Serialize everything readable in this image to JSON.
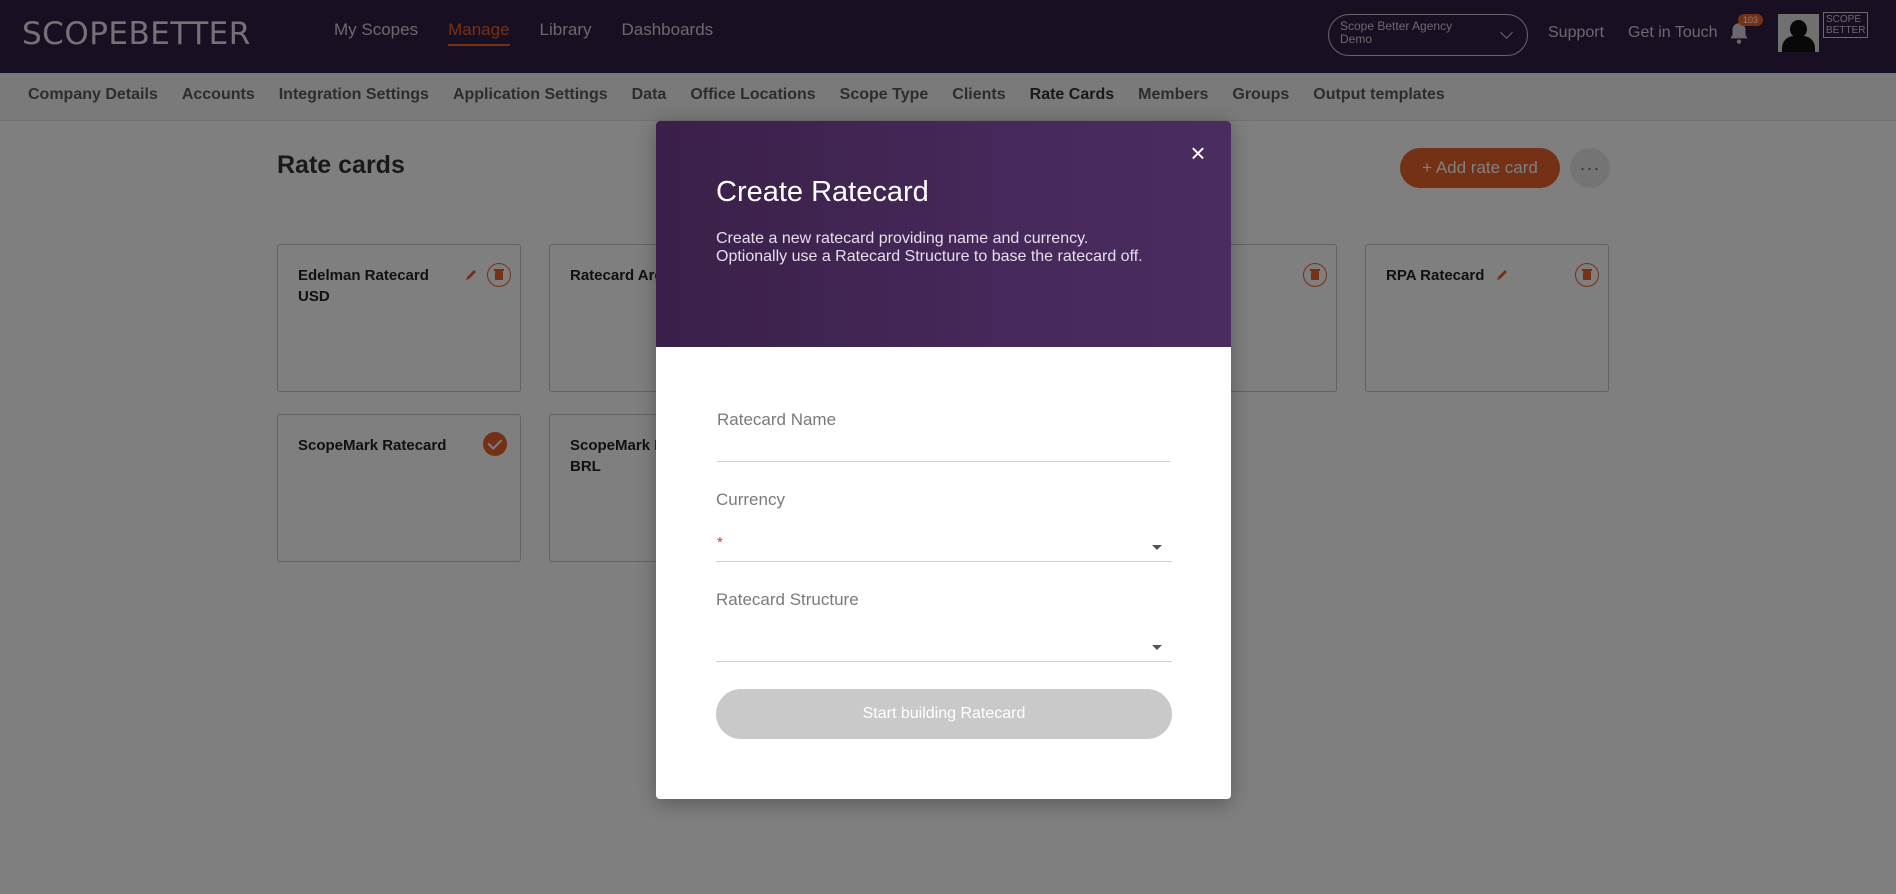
{
  "brand": {
    "logo_text": "SCOPEBETTER",
    "accent": "#e8622a",
    "header_bg": "#321f44"
  },
  "main_nav": [
    {
      "label": "My Scopes"
    },
    {
      "label": "Manage",
      "active": true
    },
    {
      "label": "Library"
    },
    {
      "label": "Dashboards"
    }
  ],
  "agency_select": {
    "line1": "Scope Better Agency",
    "line2": "Demo"
  },
  "top_links": {
    "support": "Support",
    "contact": "Get in Touch"
  },
  "notifications": {
    "count": "103"
  },
  "minilogo": {
    "line1": "SCOPE",
    "line2": "BETTER"
  },
  "sub_nav": [
    {
      "label": "Company Details"
    },
    {
      "label": "Accounts"
    },
    {
      "label": "Integration Settings"
    },
    {
      "label": "Application Settings"
    },
    {
      "label": "Data"
    },
    {
      "label": "Office Locations"
    },
    {
      "label": "Scope Type"
    },
    {
      "label": "Clients"
    },
    {
      "label": "Rate Cards",
      "active": true
    },
    {
      "label": "Members"
    },
    {
      "label": "Groups"
    },
    {
      "label": "Output templates"
    }
  ],
  "page": {
    "title": "Rate cards",
    "add_button": "+ Add rate card",
    "more_button": "···"
  },
  "cards": [
    {
      "name": "Edelman Ratecard USD"
    },
    {
      "name": "Ratecard Argentina"
    },
    {
      "name": "RPA Ratecard"
    },
    {
      "name": "ScopeMark Ratecard",
      "default": true
    },
    {
      "name": "ScopeMark Ratecard BRL"
    }
  ],
  "modal": {
    "close": "×",
    "title": "Create Ratecard",
    "description": "Create a new ratecard providing name and currency. Optionally use a Ratecard Structure to base the ratecard off.",
    "name_label": "Ratecard Name",
    "name_value": "",
    "currency_label": "Currency",
    "currency_required": "*",
    "structure_label": "Ratecard Structure",
    "submit_label": "Start building Ratecard"
  }
}
